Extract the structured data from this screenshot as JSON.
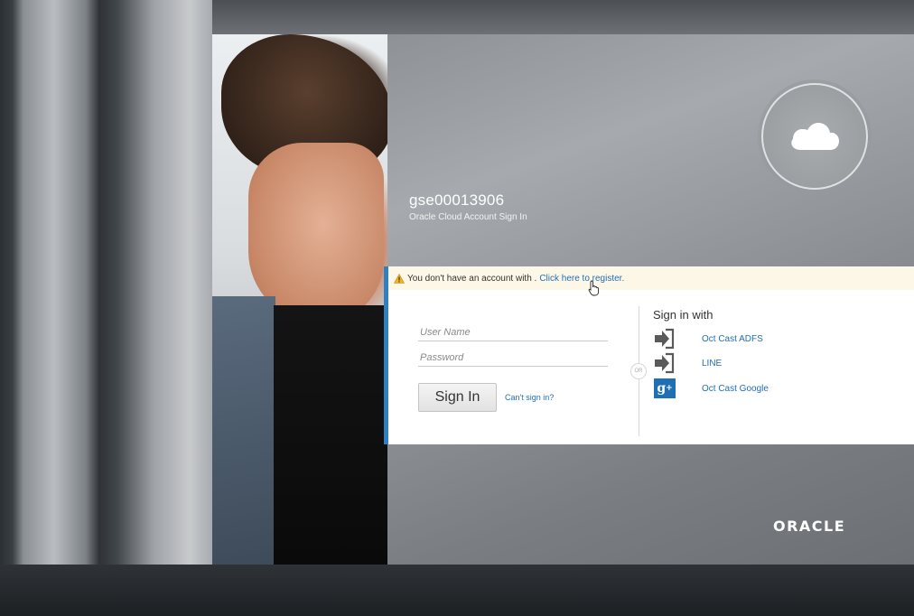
{
  "header": {
    "tenant": "gse00013906",
    "subtitle": "Oracle Cloud Account Sign In",
    "badge_icon": "cloud-icon"
  },
  "notice": {
    "icon": "warning-icon",
    "message": "You don't have an account with .",
    "register_link": "Click here to register."
  },
  "login": {
    "username_placeholder": "User Name",
    "password_placeholder": "Password",
    "signin_label": "Sign In",
    "cant_signin": "Can't sign in?"
  },
  "separator": {
    "or_label": "OR"
  },
  "sso": {
    "title": "Sign in with",
    "providers": [
      {
        "label": "Oct Cast ADFS",
        "icon": "sign-in-arrow-icon"
      },
      {
        "label": "LINE",
        "icon": "sign-in-arrow-icon"
      },
      {
        "label": "Oct Cast Google",
        "icon": "google-plus-icon"
      }
    ]
  },
  "footer": {
    "logo_text": "ORACLE"
  },
  "colors": {
    "accent": "#2f7fc1",
    "link": "#1f6fb5",
    "warning_bg": "#fdf7e8"
  }
}
